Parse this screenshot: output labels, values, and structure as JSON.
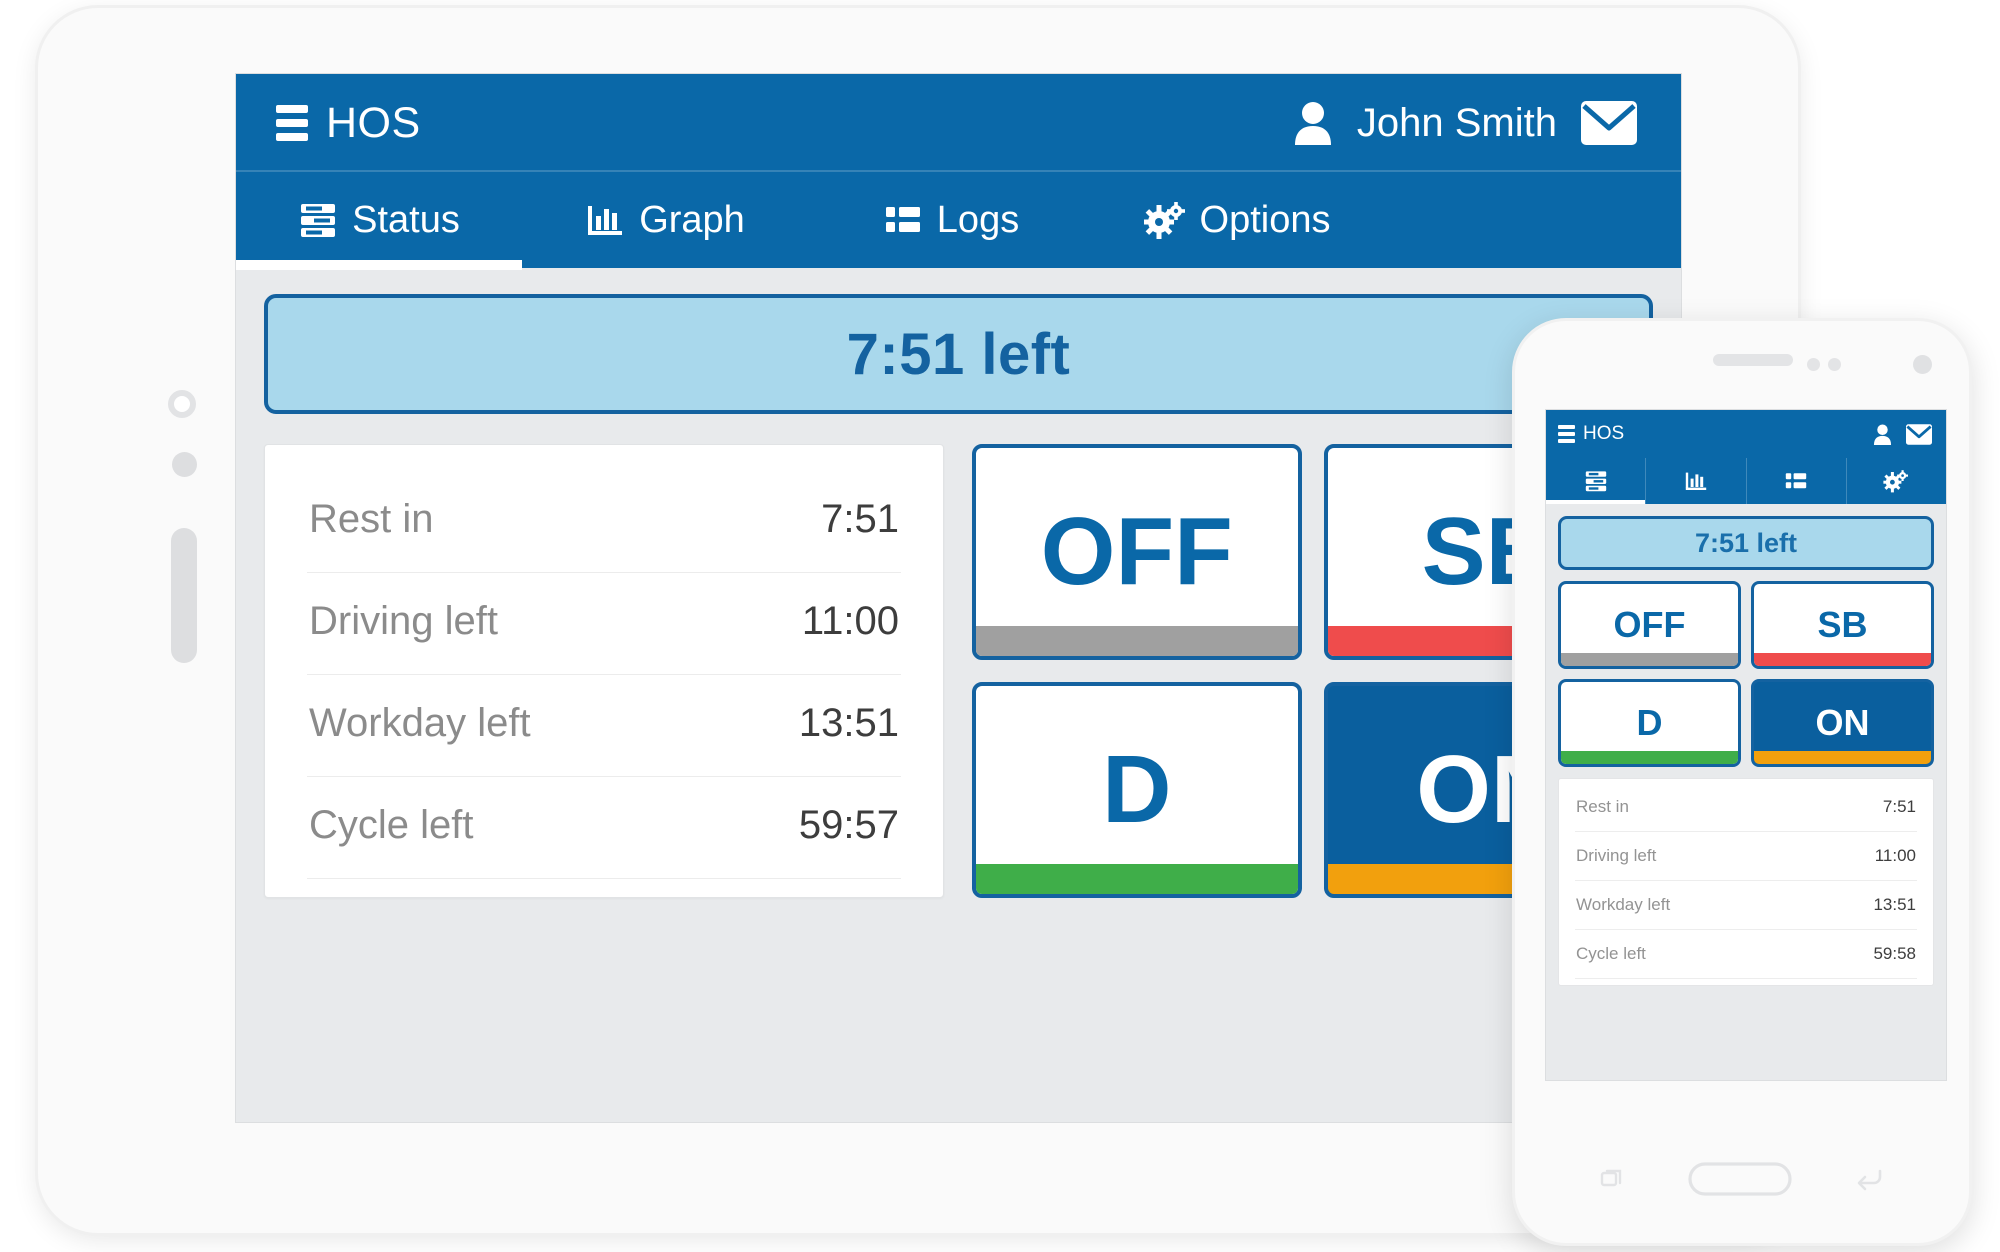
{
  "app": {
    "brand": "HOS",
    "user_name": "John Smith",
    "menu_icon": "hamburger-icon",
    "user_icon": "person-icon",
    "mail_icon": "envelope-icon",
    "header_bg": "#0a68a8",
    "accent_blue": "#1462a0",
    "banner_bg": "#a9d8ec"
  },
  "tabs": [
    {
      "label": "Status",
      "icon": "status-list-icon",
      "active": true
    },
    {
      "label": "Graph",
      "icon": "bar-chart-icon",
      "active": false
    },
    {
      "label": "Logs",
      "icon": "list-icon",
      "active": false
    },
    {
      "label": "Options",
      "icon": "gears-icon",
      "active": false
    }
  ],
  "tablet": {
    "banner": "7:51 left",
    "stats": [
      {
        "label": "Rest in",
        "value": "7:51"
      },
      {
        "label": "Driving left",
        "value": "11:00"
      },
      {
        "label": "Workday left",
        "value": "13:51"
      },
      {
        "label": "Cycle left",
        "value": "59:57"
      }
    ],
    "duty_buttons": [
      {
        "label": "OFF",
        "bar_color": "#a0a0a0",
        "selected": false
      },
      {
        "label": "SB",
        "bar_color": "#ef4c4c",
        "selected": false
      },
      {
        "label": "D",
        "bar_color": "#3fae49",
        "selected": false
      },
      {
        "label": "ON",
        "bar_color": "#f2a00d",
        "selected": true
      }
    ]
  },
  "phone": {
    "banner": "7:51 left",
    "stats": [
      {
        "label": "Rest in",
        "value": "7:51"
      },
      {
        "label": "Driving left",
        "value": "11:00"
      },
      {
        "label": "Workday left",
        "value": "13:51"
      },
      {
        "label": "Cycle left",
        "value": "59:58"
      }
    ],
    "duty_buttons": [
      {
        "label": "OFF",
        "bar_color": "#a0a0a0",
        "selected": false
      },
      {
        "label": "SB",
        "bar_color": "#ef4c4c",
        "selected": false
      },
      {
        "label": "D",
        "bar_color": "#3fae49",
        "selected": false
      },
      {
        "label": "ON",
        "bar_color": "#f2a00d",
        "selected": true
      }
    ],
    "nav": [
      {
        "icon": "recents-icon"
      },
      {
        "icon": "home-icon"
      },
      {
        "icon": "back-icon"
      }
    ]
  }
}
